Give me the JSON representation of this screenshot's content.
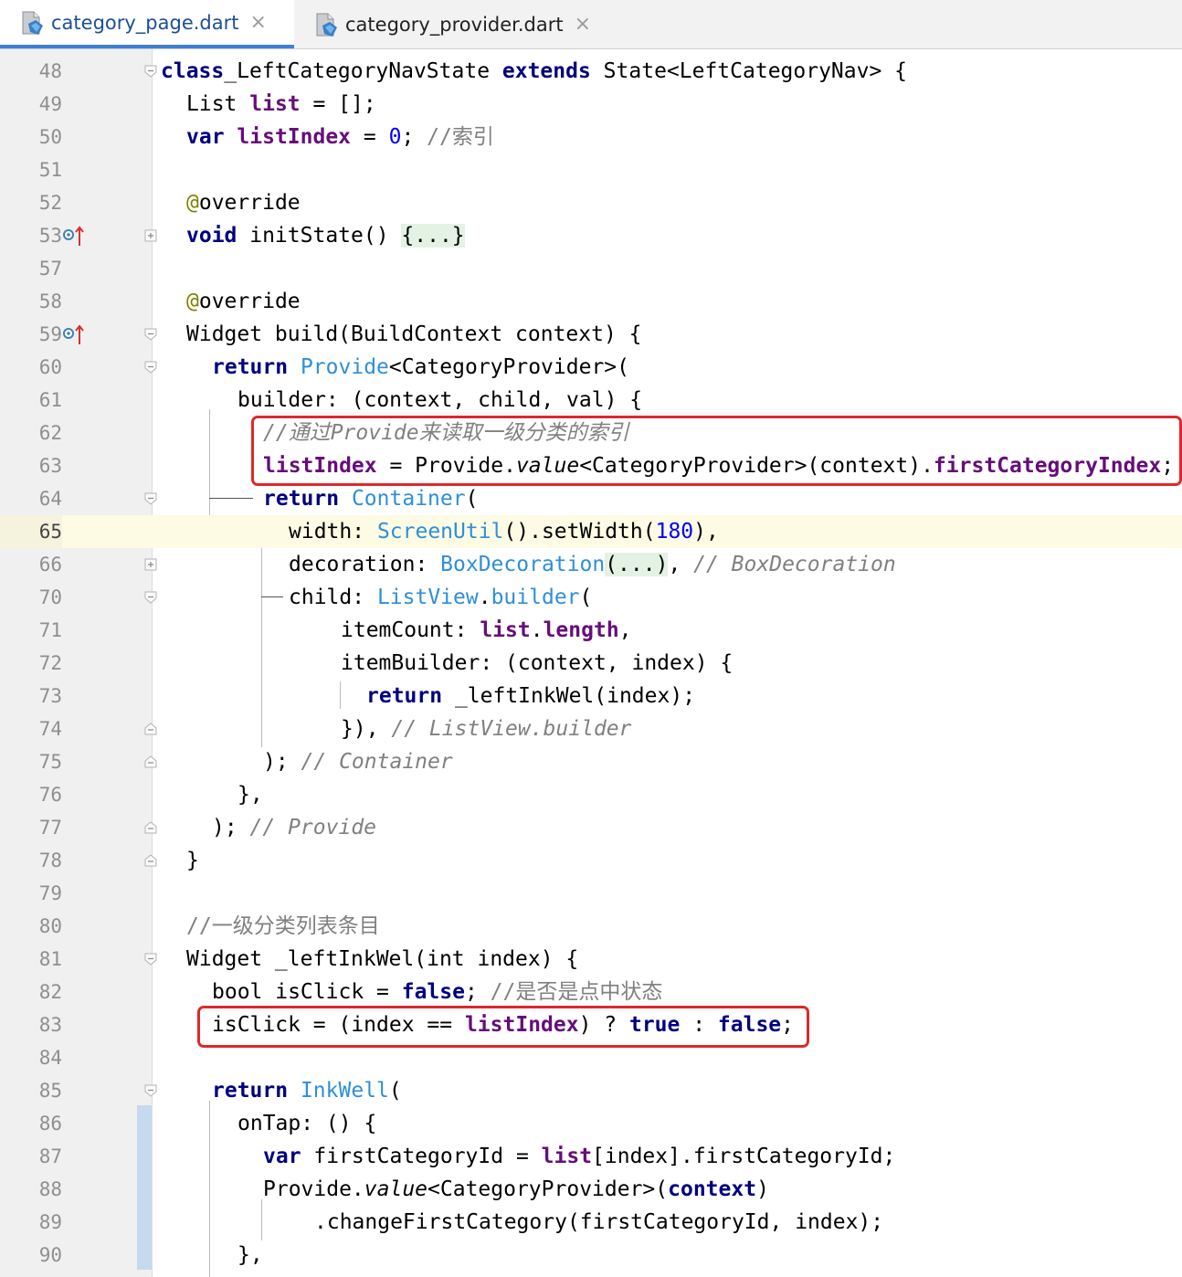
{
  "tabs": [
    {
      "label": "category_page.dart",
      "active": true,
      "icon": "dart-file-icon"
    },
    {
      "label": "category_provider.dart",
      "active": false,
      "icon": "dart-file-icon"
    }
  ],
  "close_glyph": "×",
  "lines": [
    {
      "num": "48",
      "indent": 0,
      "fold": "open",
      "parts": [
        [
          "k",
          "class"
        ],
        [
          "",
          "_LeftCategoryNavState "
        ],
        [
          "k",
          "extends"
        ],
        [
          "",
          " State<LeftCategoryNav> {"
        ]
      ]
    },
    {
      "num": "49",
      "indent": 1,
      "parts": [
        [
          "",
          "List "
        ],
        [
          "f",
          "list"
        ],
        [
          "",
          " = [];"
        ]
      ]
    },
    {
      "num": "50",
      "indent": 1,
      "parts": [
        [
          "k",
          "var"
        ],
        [
          "",
          " "
        ],
        [
          "f",
          "listIndex"
        ],
        [
          "",
          " = "
        ],
        [
          "n",
          "0"
        ],
        [
          "",
          "; "
        ],
        [
          "cz",
          "//索引"
        ]
      ]
    },
    {
      "num": "51",
      "indent": 1,
      "parts": []
    },
    {
      "num": "52",
      "indent": 1,
      "parts": [
        [
          "a",
          "@"
        ],
        [
          "",
          "override"
        ]
      ]
    },
    {
      "num": "53",
      "indent": 1,
      "fold": "collapsed",
      "override": true,
      "parts": [
        [
          "k",
          "void"
        ],
        [
          "",
          " initState() "
        ],
        [
          "fb",
          "{...}"
        ]
      ]
    },
    {
      "num": "57",
      "indent": 1,
      "parts": []
    },
    {
      "num": "58",
      "indent": 1,
      "parts": [
        [
          "a",
          "@"
        ],
        [
          "",
          "override"
        ]
      ]
    },
    {
      "num": "59",
      "indent": 1,
      "fold": "open",
      "override": true,
      "parts": [
        [
          "",
          "Widget build(BuildContext context) {"
        ]
      ]
    },
    {
      "num": "60",
      "indent": 2,
      "fold": "open",
      "parts": [
        [
          "k",
          "return"
        ],
        [
          "",
          " "
        ],
        [
          "t",
          "Provide"
        ],
        [
          "",
          "<CategoryProvider>("
        ]
      ]
    },
    {
      "num": "61",
      "indent": 3,
      "parts": [
        [
          "",
          "builder: (context, child, val) {"
        ]
      ]
    },
    {
      "num": "62",
      "indent": 4,
      "parts": [
        [
          "c",
          "//通过Provide来读取一级分类的索引"
        ]
      ]
    },
    {
      "num": "63",
      "indent": 4,
      "parts": [
        [
          "f",
          "listIndex"
        ],
        [
          "",
          " = Provide."
        ],
        [
          "i",
          "value"
        ],
        [
          "",
          "<CategoryProvider>(context)."
        ],
        [
          "f",
          "firstCategoryIndex"
        ],
        [
          "",
          ";"
        ]
      ]
    },
    {
      "num": "64",
      "indent": 4,
      "fold": "open",
      "parts": [
        [
          "k",
          "return"
        ],
        [
          "",
          " "
        ],
        [
          "t",
          "Container"
        ],
        [
          "",
          "("
        ]
      ]
    },
    {
      "num": "65",
      "indent": 5,
      "current": true,
      "parts": [
        [
          "",
          "width: "
        ],
        [
          "t",
          "ScreenUtil"
        ],
        [
          "",
          "().setWidth("
        ],
        [
          "n",
          "180"
        ],
        [
          "",
          "),"
        ]
      ]
    },
    {
      "num": "66",
      "indent": 5,
      "fold": "collapsed",
      "parts": [
        [
          "",
          "decoration: "
        ],
        [
          "t",
          "BoxDecoration"
        ],
        [
          "fb",
          "(...)"
        ],
        [
          "",
          ", "
        ],
        [
          "c",
          "// BoxDecoration"
        ]
      ]
    },
    {
      "num": "70",
      "indent": 5,
      "fold": "open",
      "parts": [
        [
          "",
          "child: "
        ],
        [
          "t",
          "ListView"
        ],
        [
          "",
          "."
        ],
        [
          "t",
          "builder"
        ],
        [
          "",
          "("
        ]
      ]
    },
    {
      "num": "71",
      "indent": 7,
      "parts": [
        [
          "",
          "itemCount: "
        ],
        [
          "f",
          "list"
        ],
        [
          "",
          "."
        ],
        [
          "f",
          "length"
        ],
        [
          "",
          ","
        ]
      ]
    },
    {
      "num": "72",
      "indent": 7,
      "parts": [
        [
          "",
          "itemBuilder: (context, index) {"
        ]
      ]
    },
    {
      "num": "73",
      "indent": 8,
      "parts": [
        [
          "k",
          "return"
        ],
        [
          "",
          " _leftInkWel(index);"
        ]
      ]
    },
    {
      "num": "74",
      "indent": 7,
      "fold": "close",
      "parts": [
        [
          "",
          "}), "
        ],
        [
          "c",
          "// ListView.builder"
        ]
      ]
    },
    {
      "num": "75",
      "indent": 4,
      "fold": "close",
      "parts": [
        [
          "",
          "); "
        ],
        [
          "c",
          "// Container"
        ]
      ]
    },
    {
      "num": "76",
      "indent": 3,
      "parts": [
        [
          "",
          "},"
        ]
      ]
    },
    {
      "num": "77",
      "indent": 2,
      "fold": "close",
      "parts": [
        [
          "",
          "); "
        ],
        [
          "c",
          "// Provide"
        ]
      ]
    },
    {
      "num": "78",
      "indent": 1,
      "fold": "close",
      "parts": [
        [
          "",
          "}"
        ]
      ]
    },
    {
      "num": "79",
      "indent": 1,
      "parts": []
    },
    {
      "num": "80",
      "indent": 1,
      "parts": [
        [
          "cz",
          "//一级分类列表条目"
        ]
      ]
    },
    {
      "num": "81",
      "indent": 1,
      "fold": "open",
      "parts": [
        [
          "",
          "Widget _leftInkWel(int index) {"
        ]
      ]
    },
    {
      "num": "82",
      "indent": 2,
      "parts": [
        [
          "",
          "bool isClick = "
        ],
        [
          "k",
          "false"
        ],
        [
          "",
          "; "
        ],
        [
          "cz",
          "//是否是点中状态"
        ]
      ]
    },
    {
      "num": "83",
      "indent": 2,
      "parts": [
        [
          "",
          "isClick = (index == "
        ],
        [
          "f",
          "listIndex"
        ],
        [
          "",
          ") ? "
        ],
        [
          "k",
          "true"
        ],
        [
          "",
          " : "
        ],
        [
          "k",
          "false"
        ],
        [
          "",
          ";"
        ]
      ]
    },
    {
      "num": "84",
      "indent": 2,
      "parts": []
    },
    {
      "num": "85",
      "indent": 2,
      "fold": "open",
      "parts": [
        [
          "k",
          "return"
        ],
        [
          "",
          " "
        ],
        [
          "t",
          "InkWell"
        ],
        [
          "",
          "("
        ]
      ]
    },
    {
      "num": "86",
      "indent": 3,
      "parts": [
        [
          "",
          "onTap: () {"
        ]
      ]
    },
    {
      "num": "87",
      "indent": 4,
      "parts": [
        [
          "k",
          "var"
        ],
        [
          "",
          " firstCategoryId = "
        ],
        [
          "f",
          "list"
        ],
        [
          "",
          "[index].firstCategoryId;"
        ]
      ]
    },
    {
      "num": "88",
      "indent": 4,
      "parts": [
        [
          "",
          "Provide."
        ],
        [
          "i",
          "value"
        ],
        [
          "",
          "<CategoryProvider>("
        ],
        [
          "k",
          "context"
        ],
        [
          "",
          ")"
        ]
      ]
    },
    {
      "num": "89",
      "indent": 6,
      "parts": [
        [
          "",
          ".changeFirstCategory(firstCategoryId, index);"
        ]
      ]
    },
    {
      "num": "90",
      "indent": 3,
      "parts": [
        [
          "",
          "},"
        ]
      ]
    }
  ],
  "colors": {
    "keyword": "#000080",
    "field": "#660e7a",
    "number": "#0000ff",
    "comment": "#808080",
    "type_ref": "#2e8fd8",
    "annotation": "#808000",
    "highlight_box": "#e0272a",
    "current_line": "#fdfbe4",
    "tab_accent": "#3d7ed6"
  }
}
